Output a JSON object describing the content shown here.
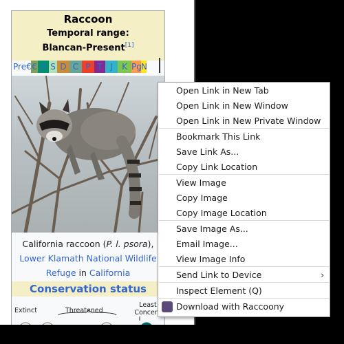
{
  "infobox": {
    "name": "Raccoon",
    "temporal_label": "Temporal range:",
    "temporal_value": "Blancan-Present",
    "ref": "[1]",
    "timescale": [
      {
        "label": "Pre€",
        "color": "#f8f9fa"
      },
      {
        "label": "€",
        "color": "#7fa056"
      },
      {
        "label": "O",
        "color": "#009270"
      },
      {
        "label": "S",
        "color": "#b3e1b6"
      },
      {
        "label": "D",
        "color": "#cb8c37"
      },
      {
        "label": "C",
        "color": "#67a599"
      },
      {
        "label": "P",
        "color": "#f04028"
      },
      {
        "label": "T",
        "color": "#812b92"
      },
      {
        "label": "J",
        "color": "#34b2c9"
      },
      {
        "label": "K",
        "color": "#7fc64e"
      },
      {
        "label": "Pg",
        "color": "#fd9a52"
      },
      {
        "label": "N",
        "color": "#ffe619"
      }
    ],
    "caption": {
      "line1_prefix": "California raccoon (",
      "line1_italic": "P. l. psora",
      "line1_suffix": "),",
      "link1": "Lower Klamath National Wildlife Refuge",
      "in_text": " in ",
      "link2": "California"
    },
    "conservation_title": "Conservation status",
    "scale": {
      "extinct": "Extinct",
      "threatened": "Threatened",
      "least": "Least Concern"
    }
  },
  "context_menu": {
    "items": [
      {
        "label": "Open Link in New Tab"
      },
      {
        "label": "Open Link in New Window"
      },
      {
        "label": "Open Link in New Private Window"
      },
      {
        "label": "Bookmark This Link"
      },
      {
        "label": "Save Link As..."
      },
      {
        "label": "Copy Link Location"
      },
      {
        "label": "View Image"
      },
      {
        "label": "Copy Image"
      },
      {
        "label": "Copy Image Location"
      },
      {
        "label": "Save Image As..."
      },
      {
        "label": "Email Image..."
      },
      {
        "label": "View Image Info"
      },
      {
        "label": "Send Link to Device",
        "submenu": "›"
      },
      {
        "label": "Inspect Element (Q)"
      },
      {
        "label": "Download with Raccoony",
        "icon": "raccoony-extension-icon"
      }
    ]
  }
}
